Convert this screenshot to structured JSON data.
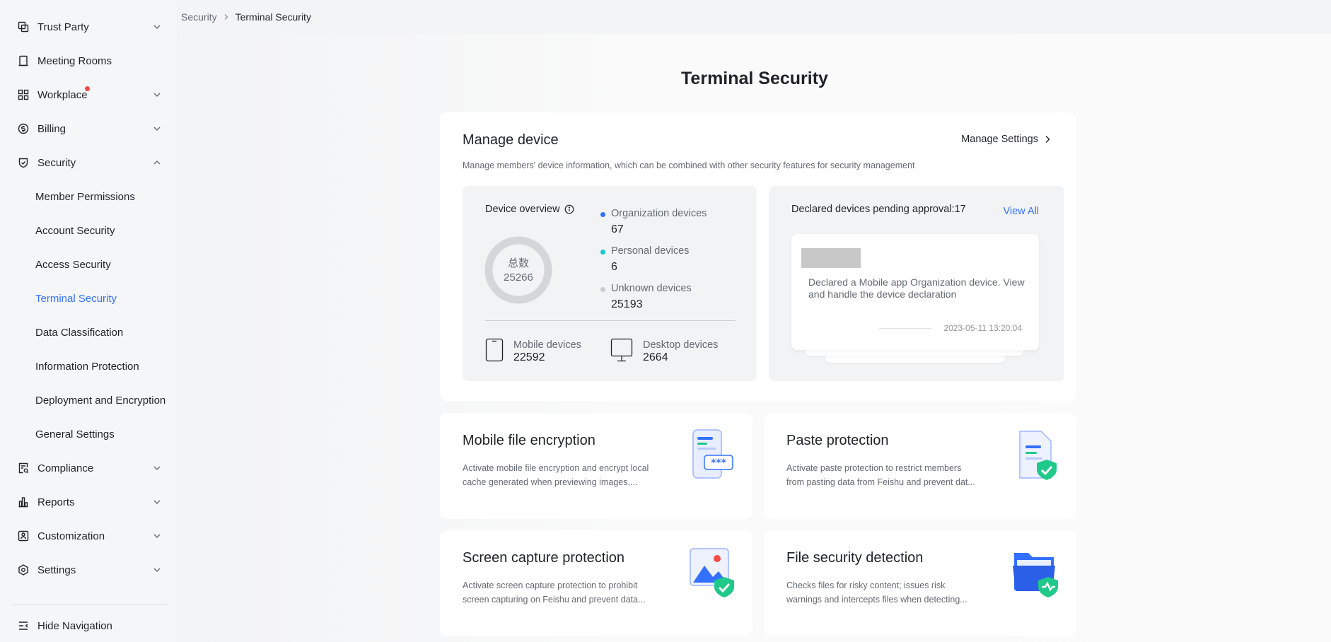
{
  "sidebar": {
    "items": [
      {
        "label": "Trust Party"
      },
      {
        "label": "Meeting Rooms"
      },
      {
        "label": "Workplace"
      },
      {
        "label": "Billing"
      },
      {
        "label": "Security"
      },
      {
        "label": "Compliance"
      },
      {
        "label": "Reports"
      },
      {
        "label": "Customization"
      },
      {
        "label": "Settings"
      }
    ],
    "security_subitems": [
      {
        "label": "Member Permissions"
      },
      {
        "label": "Account Security"
      },
      {
        "label": "Access Security"
      },
      {
        "label": "Terminal Security",
        "active": true
      },
      {
        "label": "Data Classification"
      },
      {
        "label": "Information Protection"
      },
      {
        "label": "Deployment and Encryption"
      },
      {
        "label": "General Settings"
      }
    ],
    "hide_nav_label": "Hide Navigation"
  },
  "breadcrumb": {
    "parent": "Security",
    "current": "Terminal Security"
  },
  "page": {
    "title": "Terminal Security"
  },
  "manage_device": {
    "title": "Manage device",
    "description": "Manage members' device information, which can be combined with other security features for security management",
    "settings_link": "Manage Settings",
    "overview": {
      "title": "Device overview",
      "total_label": "总数",
      "total_value": "25266",
      "legend": [
        {
          "label": "Organization devices",
          "value": "67",
          "color": "#3370ff"
        },
        {
          "label": "Personal devices",
          "value": "6",
          "color": "#14c9c9"
        },
        {
          "label": "Unknown devices",
          "value": "25193",
          "color": "#c9cdd4"
        }
      ],
      "mobile_label": "Mobile devices",
      "mobile_value": "22592",
      "desktop_label": "Desktop devices",
      "desktop_value": "2664"
    },
    "pending": {
      "title": "Declared devices pending approval:17",
      "view_all": "View All",
      "card_text": "Declared a Mobile app Organization device. View and handle the device declaration",
      "card_time": "2023-05-11 13:20:04"
    }
  },
  "features": [
    {
      "title": "Mobile file encryption",
      "description": "Activate mobile file encryption and encrypt local cache generated when previewing images,..."
    },
    {
      "title": "Paste protection",
      "description": "Activate paste protection to restrict members from pasting data from Feishu and prevent dat..."
    },
    {
      "title": "Screen capture protection",
      "description": "Activate screen capture protection to prohibit screen capturing on Feishu and prevent data..."
    },
    {
      "title": "File security detection",
      "description": "Checks files for risky content; issues risk warnings and intercepts files when detecting..."
    }
  ],
  "colors": {
    "accent": "#3370ff",
    "alert_dot": "#f54a45",
    "teal": "#14c9c9",
    "green_check": "#1fc98a"
  }
}
